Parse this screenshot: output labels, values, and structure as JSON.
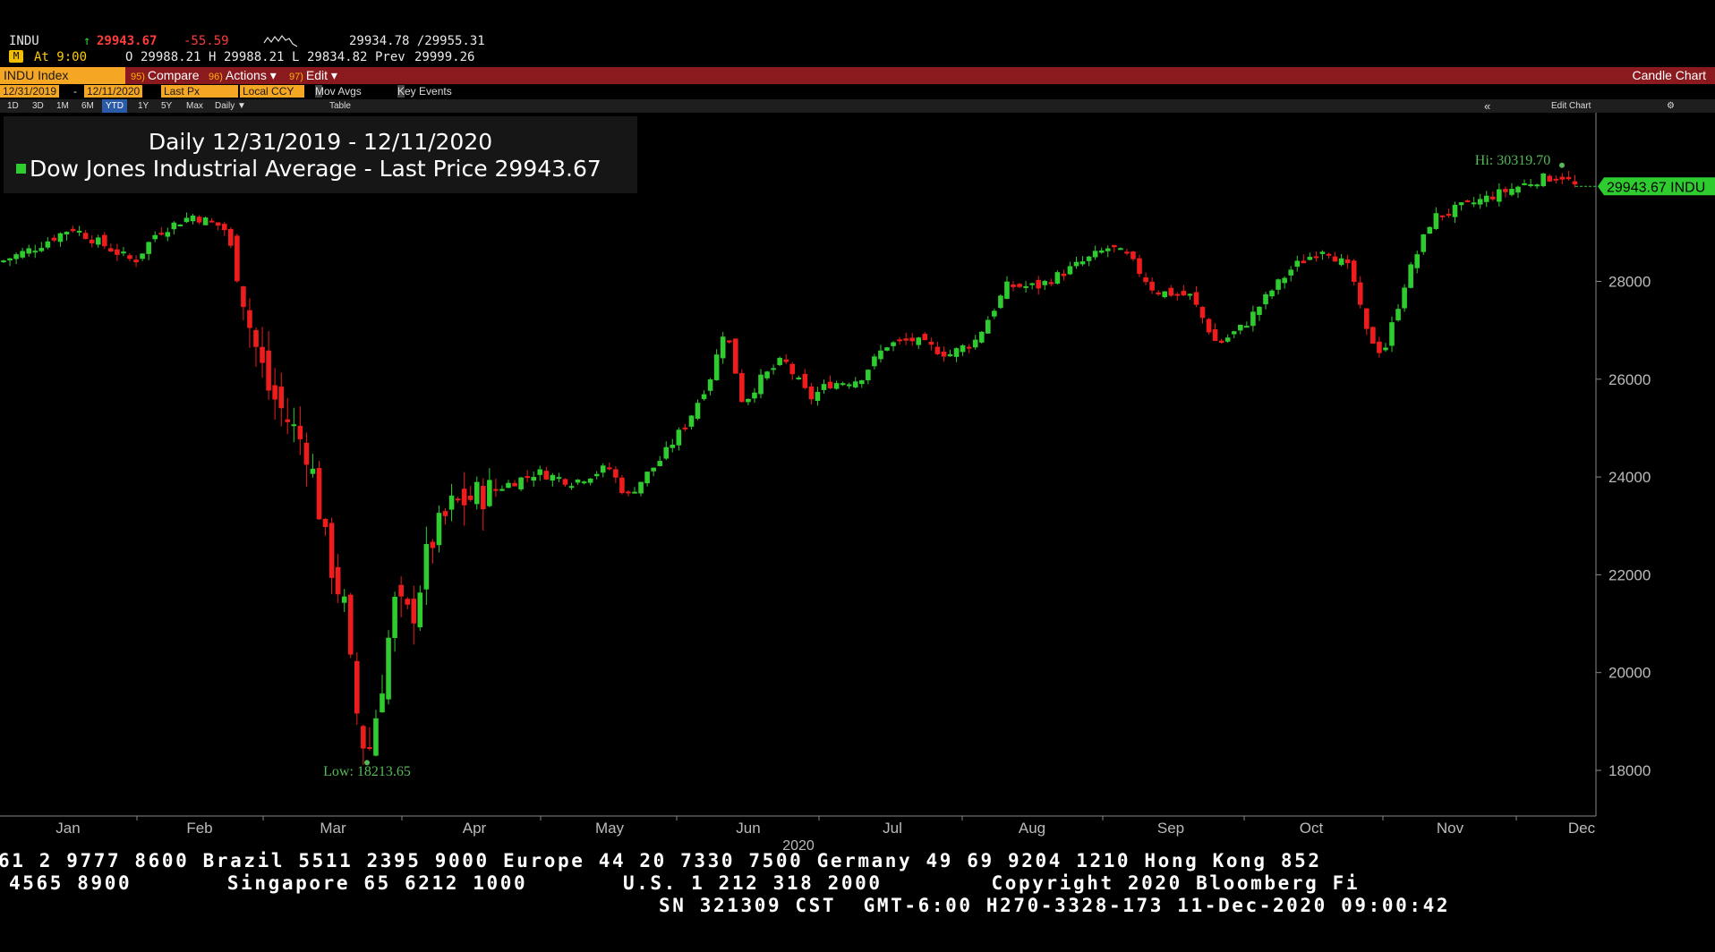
{
  "quote": {
    "symbol": "INDU",
    "arrow": "↑",
    "last": "29943.67",
    "change": "-55.59",
    "bid_ask": "29934.78 /29955.31",
    "badge": "M",
    "time": "At 9:00",
    "open_label": "O",
    "open": "29988.21",
    "high_label": "H",
    "high": "29988.21",
    "low_label": "L",
    "low": "29834.82",
    "prev_label": "Prev",
    "prev": "29999.26"
  },
  "menubar": {
    "security": "INDU Index",
    "compare_num": "95)",
    "compare": "Compare",
    "actions_num": "96)",
    "actions": "Actions ▾",
    "edit_num": "97)",
    "edit": "Edit ▾",
    "right_title": "Candle Chart"
  },
  "params": {
    "start": "12/31/2019",
    "dash": "-",
    "end": "12/11/2020",
    "field": "Last Px",
    "ccy": "Local CCY",
    "mov_avgs": "Mov Avgs",
    "key_events": "Key Events"
  },
  "ranges": {
    "items": [
      "1D",
      "3D",
      "1M",
      "6M",
      "YTD",
      "1Y",
      "5Y",
      "Max"
    ],
    "selected": "YTD",
    "period": "Daily ▼",
    "table": "Table",
    "collapse": "«",
    "edit_chart": "Edit Chart",
    "settings": "⚙"
  },
  "title": {
    "line1": "Daily 12/31/2019 - 12/11/2020",
    "line2": "Dow Jones Industrial Average - Last Price 29943.67"
  },
  "colors": {
    "up": "#2fcc2f",
    "down": "#ee1c1c",
    "annot": "#57b857",
    "axis": "#bbbbbb",
    "menubar": "#8b1a1f"
  },
  "chart_data": {
    "type": "candlestick",
    "title": "Daily 12/31/2019 - 12/11/2020",
    "series_name": "Dow Jones Industrial Average - Last Price 29943.67",
    "ylim": [
      17100,
      31400
    ],
    "y_ticks": [
      18000,
      20000,
      22000,
      24000,
      26000,
      28000
    ],
    "y_tick_labels": [
      "18000",
      "20000",
      "22000",
      "24000",
      "26000",
      "28000"
    ],
    "x_ticks": [
      "Jan",
      "Feb",
      "Mar",
      "Apr",
      "May",
      "Jun",
      "Jul",
      "Aug",
      "Sep",
      "Oct",
      "Nov",
      "Dec"
    ],
    "x_year_label": "2020",
    "hi_label": "Hi: 30319.70",
    "hi_value": 30319.7,
    "low_label": "Low: 18213.65",
    "low_value": 18213.65,
    "last_label": "29943.67 INDU",
    "last_value": 29943.67,
    "monthly_closes": [
      {
        "month": "Dec-2019",
        "close": 28538
      },
      {
        "month": "Jan",
        "close": 28256
      },
      {
        "month": "Feb",
        "close": 25409
      },
      {
        "month": "Mar",
        "close": 21917
      },
      {
        "month": "Apr",
        "close": 24346
      },
      {
        "month": "May",
        "close": 25383
      },
      {
        "month": "Jun",
        "close": 25813
      },
      {
        "month": "Jul",
        "close": 26428
      },
      {
        "month": "Aug",
        "close": 28430
      },
      {
        "month": "Sep",
        "close": 27782
      },
      {
        "month": "Oct",
        "close": 26502
      },
      {
        "month": "Nov",
        "close": 29638
      },
      {
        "month": "Dec-11",
        "close": 29943.67
      }
    ]
  },
  "ticker": {
    "line1": "61 2 9777 8600 Brazil 5511 2395 9000 Europe 44 20 7330 7500 Germany 49 69 9204 1210 Hong Kong 852",
    "line2": "4565 8900       Singapore 65 6212 1000       U.S. 1 212 318 2000        Copyright 2020 Bloomberg Fi",
    "line3": "SN 321309 CST  GMT-6:00 H270-3328-173 11-Dec-2020 09:00:42"
  }
}
